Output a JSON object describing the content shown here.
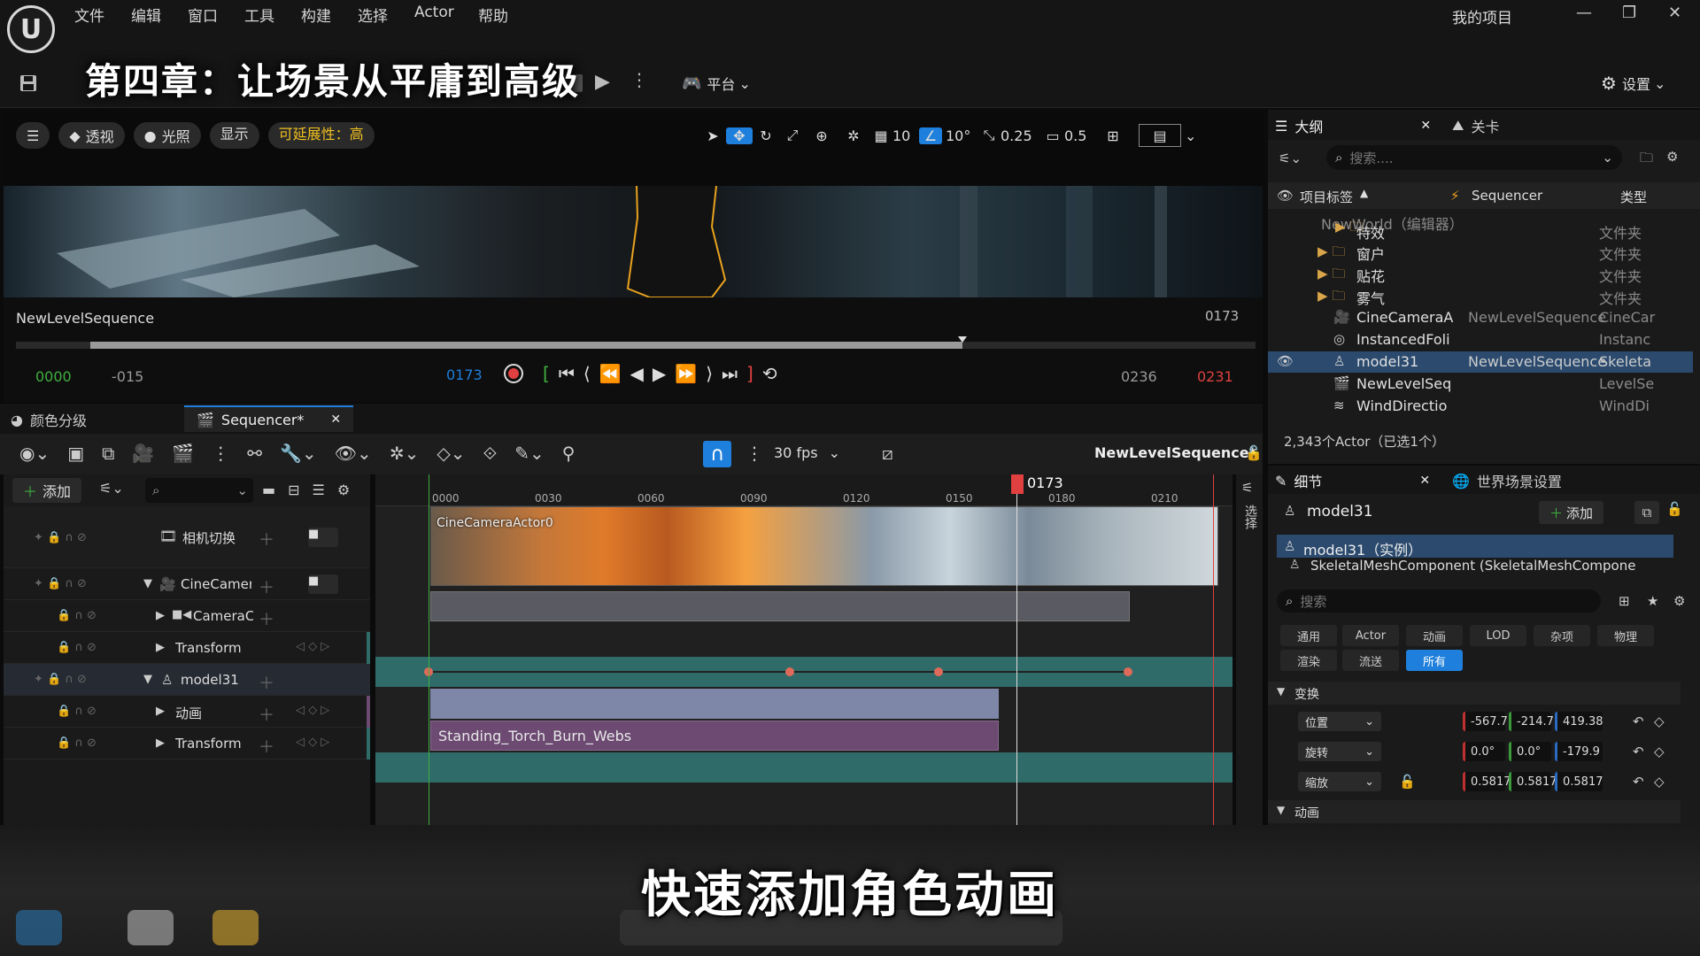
{
  "menubar": {
    "logo": "U",
    "items": [
      "文件",
      "编辑",
      "窗口",
      "工具",
      "构建",
      "选择",
      "Actor",
      "帮助"
    ],
    "project": "我的项目"
  },
  "overlay": {
    "chapter_title": "第四章：让场景从平庸到高级",
    "subtitle": "快速添加角色动画"
  },
  "toolbar": {
    "platform": "平台",
    "settings": "设置"
  },
  "viewport": {
    "perspective": "透视",
    "lighting": "光照",
    "show": "显示",
    "scalability": "可延展性：高",
    "grid": "10",
    "angle": "10°",
    "scale": "0.25",
    "camera_speed": "0.5"
  },
  "preview": {
    "sequence_name": "NewLevelSequence",
    "frame_top": "0173",
    "start": "0000",
    "pre": "-015",
    "current": "0173",
    "end_in": "0236",
    "end_out": "0231",
    "progress": 0.76
  },
  "tabs": {
    "color": "颜色分级",
    "sequencer": "Sequencer*"
  },
  "sequencer": {
    "fps": "30 fps",
    "sequence_title": "NewLevelSequence*",
    "add": "添加",
    "playhead": "0173",
    "side_label": "选择",
    "ruler": [
      "0000",
      "0030",
      "0060",
      "0090",
      "0120",
      "0150",
      "0180",
      "0210"
    ],
    "tracks": [
      "相机切换",
      "CineCamer",
      "CameraC",
      "Transform",
      "model31",
      "动画",
      "Transform"
    ],
    "camera_clip": "CineCameraActor0",
    "anim_clip": "Standing_Torch_Burn_Webs"
  },
  "outliner": {
    "tab": "大纲",
    "tab2": "关卡",
    "search": "搜索....",
    "col_label": "项目标签",
    "col_seq": "Sequencer",
    "col_type": "类型",
    "world": "NewWorld（编辑器）",
    "rows": [
      {
        "name": "特效",
        "seq": "",
        "type": "文件夹"
      },
      {
        "name": "窗户",
        "seq": "",
        "type": "文件夹"
      },
      {
        "name": "贴花",
        "seq": "",
        "type": "文件夹"
      },
      {
        "name": "雾气",
        "seq": "",
        "type": "文件夹"
      },
      {
        "name": "CineCameraA",
        "seq": "NewLevelSequence",
        "type": "CineCar"
      },
      {
        "name": "InstancedFoli",
        "seq": "",
        "type": "Instanc"
      },
      {
        "name": "model31",
        "seq": "NewLevelSequence",
        "type": "Skeleta"
      },
      {
        "name": "NewLevelSeq",
        "seq": "",
        "type": "LevelSe"
      },
      {
        "name": "WindDirectio",
        "seq": "",
        "type": "WindDi"
      }
    ],
    "count": "2,343个Actor（已选1个）"
  },
  "details": {
    "tab": "细节",
    "tab2": "世界场景设置",
    "name": "model31",
    "add": "添加",
    "instance": "model31（实例）",
    "component": "SkeletalMeshComponent (SkeletalMeshCompone",
    "search": "搜索",
    "cats": [
      "通用",
      "Actor",
      "动画",
      "LOD",
      "杂项",
      "物理",
      "渲染",
      "流送",
      "所有"
    ],
    "transform": "变换",
    "location": {
      "label": "位置",
      "x": "-567.7:",
      "y": "-214.7",
      "z": "419.38"
    },
    "rotation": {
      "label": "旋转",
      "x": "0.0°",
      "y": "0.0°",
      "z": "-179.9"
    },
    "scale": {
      "label": "缩放",
      "x": "0.5817",
      "y": "0.5817",
      "z": "0.5817"
    },
    "anim_section": "动画"
  },
  "colors": {
    "accent": "#1e7fdc",
    "teal": "#2f6b68",
    "purple": "#6c4a72",
    "red": "#e04040",
    "green": "#3fae3f"
  }
}
